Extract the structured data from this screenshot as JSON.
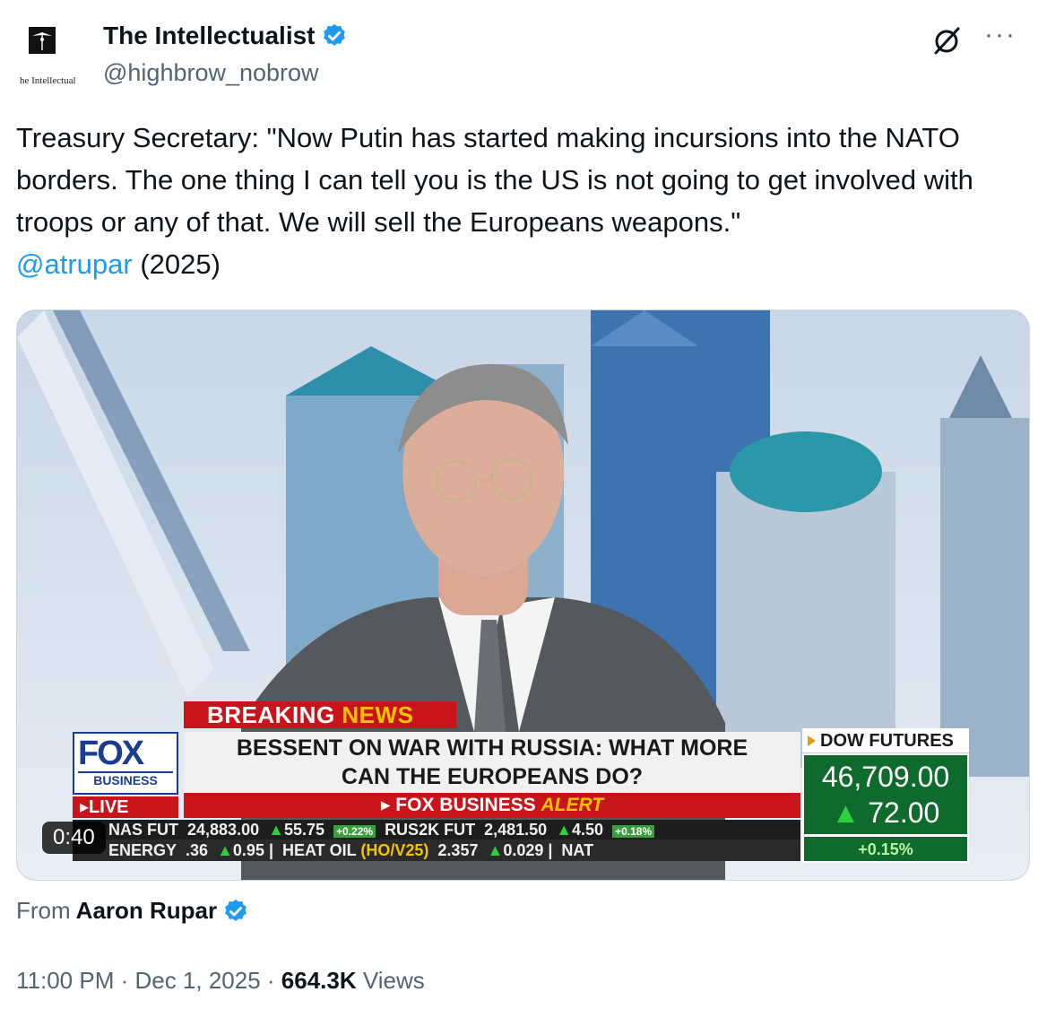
{
  "author": {
    "display_name": "The Intellectualist",
    "handle": "@highbrow_nobrow",
    "avatar_text": "he Intellectual"
  },
  "tweet": {
    "text": "Treasury Secretary: \"Now Putin has started making incursions into the NATO borders. The one thing I can tell you is the US is not going to get involved with troops or any of that. We will sell the Europeans weapons.\"",
    "mention": "@atrupar",
    "year_suffix": "(2025)"
  },
  "video": {
    "duration": "0:40",
    "breaking_prefix": "BREAKING ",
    "breaking_news": "NEWS",
    "fox": "FOX",
    "business": "BUSINESS",
    "live": "LIVE",
    "headline_line1": "BESSENT ON WAR WITH RUSSIA: WHAT MORE",
    "headline_line2": "CAN THE EUROPEANS DO?",
    "alert_prefix": "FOX BUSINESS ",
    "alert_word": "ALERT",
    "dow_label": "DOW FUTURES",
    "dow_value": "46,709.00",
    "dow_change": "72.00",
    "dow_pct": "+0.15",
    "dow_pct_sign": "%",
    "ticker_row1": {
      "a": "NAS FUT",
      "b": "24,883.00",
      "c": "55.75",
      "d": "+0.22%",
      "e": "RUS2K FUT",
      "f": "2,481.50",
      "g": "4.50",
      "h": "+0.18%"
    },
    "ticker_row2": {
      "a": "ENERGY",
      "b": ".36",
      "c": "0.95",
      "d": "HEAT OIL",
      "e": "(HO/V25)",
      "f": "2.357",
      "g": "0.029",
      "h": "NAT"
    }
  },
  "source": {
    "from_label": "From",
    "name": "Aaron Rupar"
  },
  "meta": {
    "time": "11:00 PM",
    "date": "Dec 1, 2025",
    "views_count": "664.3K",
    "views_label": "Views"
  },
  "colors": {
    "link": "#1d9bf0",
    "verified": "#1d9bf0",
    "secondary_text": "#536471"
  }
}
